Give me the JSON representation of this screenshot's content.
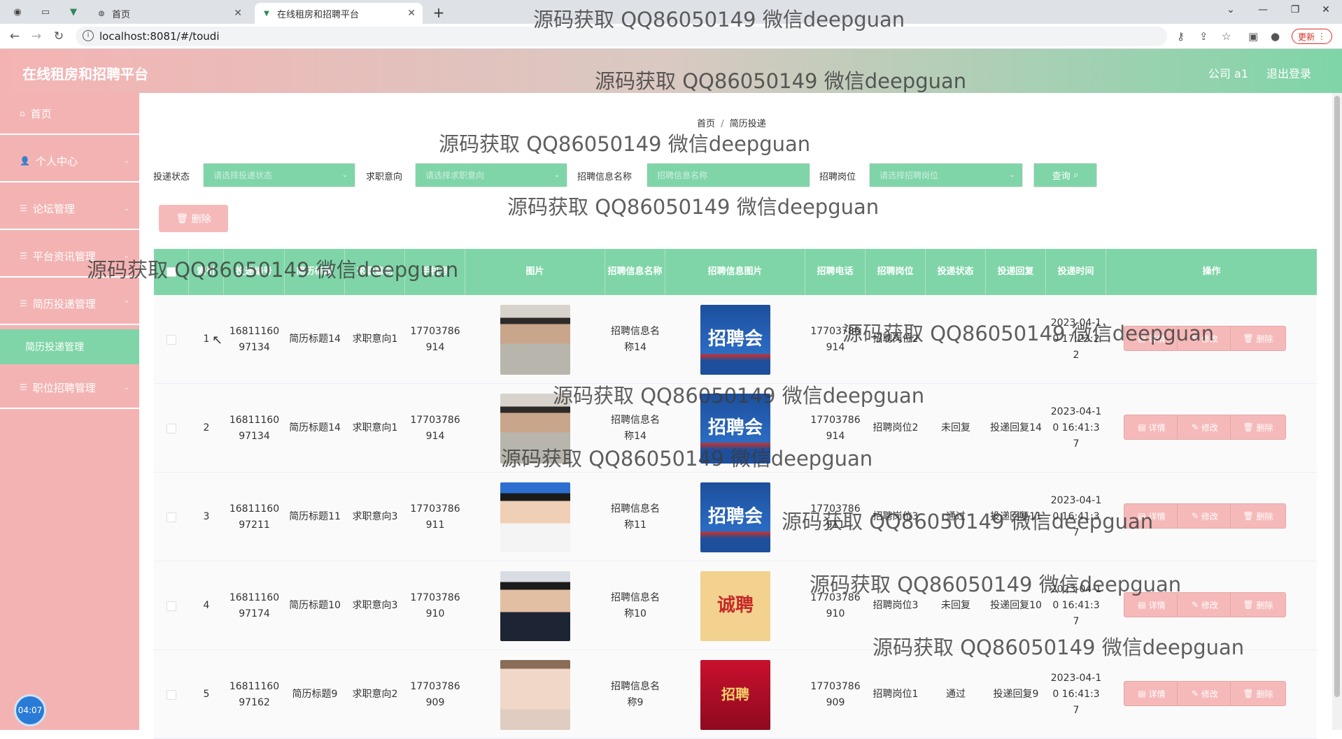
{
  "browser": {
    "tabs": [
      {
        "title": "首页",
        "active": false
      },
      {
        "title": "在线租房和招聘平台",
        "active": true
      }
    ],
    "url": "localhost:8081/#/toudi",
    "update_label": "更新"
  },
  "app": {
    "title": "在线租房和招聘平台",
    "user": "公司 a1",
    "logout": "退出登录"
  },
  "sidebar": {
    "items": [
      {
        "label": "首页"
      },
      {
        "label": "个人中心"
      },
      {
        "label": "论坛管理"
      },
      {
        "label": "平台资讯管理"
      },
      {
        "label": "简历投递管理"
      },
      {
        "label": "简历投递管理",
        "sub": true
      },
      {
        "label": "职位招聘管理"
      }
    ],
    "clock": "04:07"
  },
  "breadcrumb": {
    "home": "首页",
    "current": "简历投递"
  },
  "filters": {
    "status_label": "投递状态",
    "status_placeholder": "请选择投递状态",
    "intent_label": "求职意向",
    "intent_placeholder": "请选择求职意向",
    "job_name_label": "招聘信息名称",
    "job_name_placeholder": "招聘信息名称",
    "position_label": "招聘岗位",
    "position_placeholder": "请选择招聘岗位",
    "query_label": "查询"
  },
  "actions": {
    "delete_label": "删除"
  },
  "table": {
    "headers": [
      "索引",
      "投递编号",
      "简历标题",
      "求职意向",
      "手机号",
      "图片",
      "招聘信息名称",
      "招聘信息图片",
      "招聘电话",
      "招聘岗位",
      "投递状态",
      "投递回复",
      "投递时间",
      "操作"
    ],
    "op_labels": {
      "detail": "详情",
      "edit": "修改",
      "delete": "删除"
    },
    "rows": [
      {
        "index": "1",
        "no": "1681116097134",
        "title": "简历标题14",
        "intent": "求职意向1",
        "phone": "17703786914",
        "photo": "man1",
        "job": "招聘信息名称14",
        "poster": "blue",
        "tel": "17703786914",
        "position": "招聘岗位2",
        "status": "",
        "reply": "",
        "time": "2023-04-10 17:23:22"
      },
      {
        "index": "2",
        "no": "1681116097134",
        "title": "简历标题14",
        "intent": "求职意向1",
        "phone": "17703786914",
        "photo": "man1",
        "job": "招聘信息名称14",
        "poster": "blue",
        "tel": "17703786914",
        "position": "招聘岗位2",
        "status": "未回复",
        "reply": "投递回复14",
        "time": "2023-04-10 16:41:37"
      },
      {
        "index": "3",
        "no": "1681116097211",
        "title": "简历标题11",
        "intent": "求职意向3",
        "phone": "17703786911",
        "photo": "man2",
        "job": "招聘信息名称11",
        "poster": "blue",
        "tel": "17703786911",
        "position": "招聘岗位3",
        "status": "通过",
        "reply": "投递回复11",
        "time": "2023-04-10 16:41:37"
      },
      {
        "index": "4",
        "no": "1681116097174",
        "title": "简历标题10",
        "intent": "求职意向3",
        "phone": "17703786910",
        "photo": "man3",
        "job": "招聘信息名称10",
        "poster": "yellow",
        "tel": "17703786910",
        "position": "招聘岗位3",
        "status": "未回复",
        "reply": "投递回复10",
        "time": "2023-04-10 16:41:37"
      },
      {
        "index": "5",
        "no": "1681116097162",
        "title": "简历标题9",
        "intent": "求职意向2",
        "phone": "17703786909",
        "photo": "woman",
        "job": "招聘信息名称9",
        "poster": "red",
        "tel": "17703786909",
        "position": "招聘岗位1",
        "status": "通过",
        "reply": "投递回复9",
        "time": "2023-04-10 16:41:37"
      }
    ]
  },
  "posters": {
    "blue": "招聘会",
    "yellow": "诚聘",
    "red": "招聘"
  },
  "watermark": "源码获取 QQ86050149 微信deepguan"
}
